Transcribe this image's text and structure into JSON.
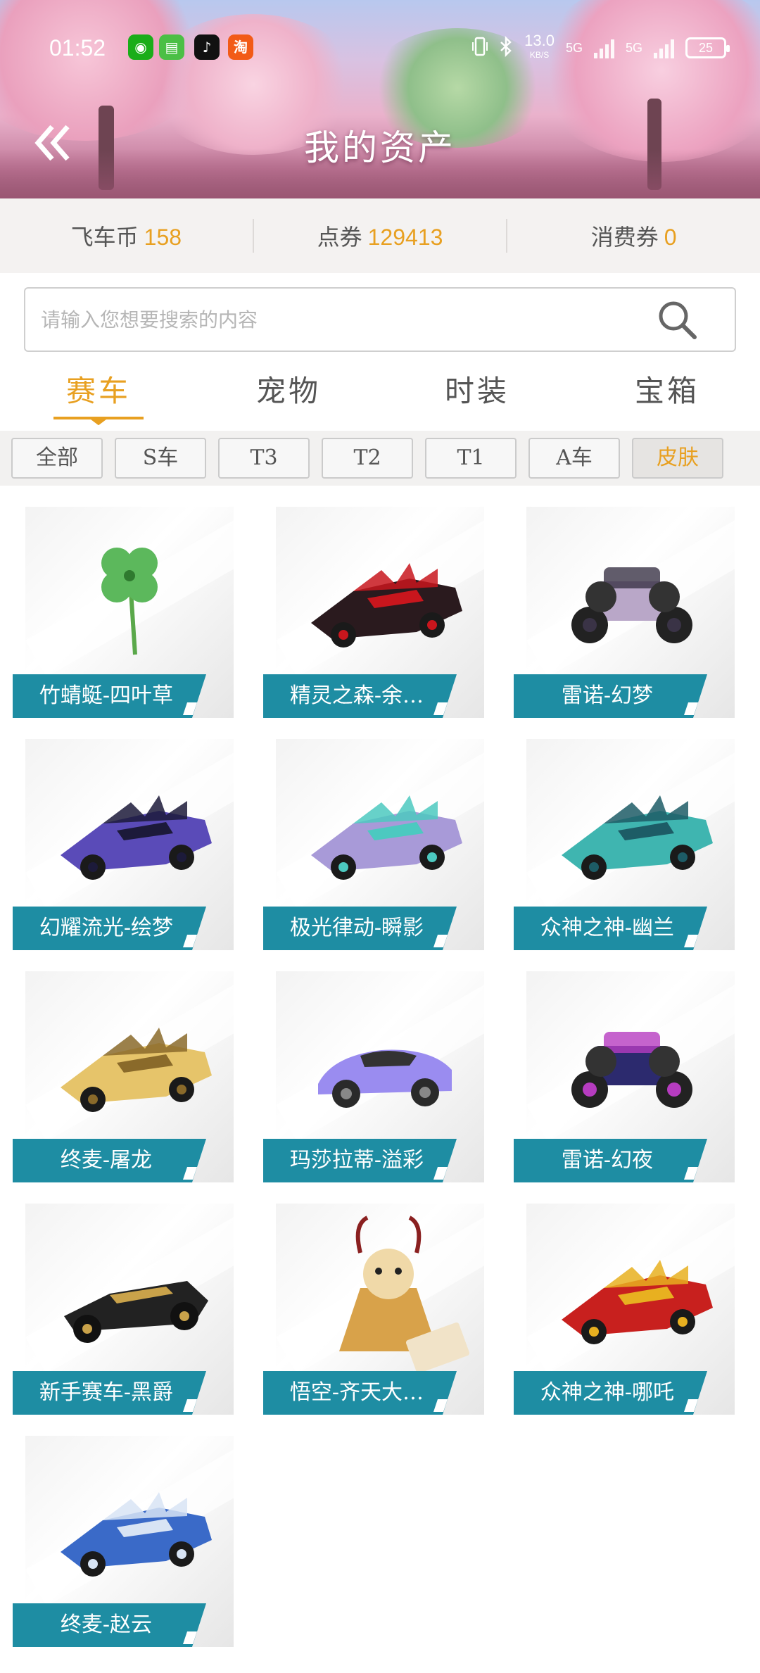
{
  "status_bar": {
    "time": "01:52",
    "net_speed": "13.0",
    "net_unit": "KB/S",
    "gen1": "5G",
    "gen2": "5G",
    "battery": "25",
    "app_icons": [
      {
        "name": "wechat-icon",
        "glyph": "◉",
        "color": "#1aad19"
      },
      {
        "name": "messages-icon",
        "glyph": "▤",
        "color": "#4bbf45"
      },
      {
        "name": "tiktok-icon",
        "glyph": "♪",
        "color": "#111111"
      },
      {
        "name": "taobao-icon",
        "glyph": "淘",
        "color": "#f25b17"
      }
    ]
  },
  "header": {
    "title": "我的资产",
    "back_icon": "double-chevron-left-icon"
  },
  "currency": [
    {
      "label": "飞车币",
      "value": "158"
    },
    {
      "label": "点券",
      "value": "129413"
    },
    {
      "label": "消费券",
      "value": "0"
    }
  ],
  "search": {
    "placeholder": "请输入您想要搜索的内容",
    "value": ""
  },
  "tabs": [
    "赛车",
    "宠物",
    "时装",
    "宝箱"
  ],
  "active_tab": 0,
  "filters": [
    "全部",
    "S车",
    "T3",
    "T2",
    "T1",
    "A车",
    "皮肤"
  ],
  "active_filter": 6,
  "items": [
    {
      "label": "竹蜻蜓-四叶草",
      "art": "clover",
      "c1": "#5cb85c",
      "c2": "#2f7a2f"
    },
    {
      "label": "精灵之森-余…",
      "art": "car",
      "c1": "#2a1a1e",
      "c2": "#c8161d"
    },
    {
      "label": "雷诺-幻梦",
      "art": "buggy",
      "c1": "#b9a7c8",
      "c2": "#3a3346"
    },
    {
      "label": "幻耀流光-绘梦",
      "art": "car",
      "c1": "#5a4bb8",
      "c2": "#1c1a3a"
    },
    {
      "label": "极光律动-瞬影",
      "art": "car",
      "c1": "#a89ad8",
      "c2": "#4cc9c0"
    },
    {
      "label": "众神之神-幽兰",
      "art": "car",
      "c1": "#3fb5b0",
      "c2": "#1d5c66"
    },
    {
      "label": "终麦-屠龙",
      "art": "car",
      "c1": "#e6c46a",
      "c2": "#8a6a2a"
    },
    {
      "label": "玛莎拉蒂-溢彩",
      "art": "sport",
      "c1": "#9a8cf0",
      "c2": "#2a2a2a"
    },
    {
      "label": "雷诺-幻夜",
      "art": "buggy",
      "c1": "#2c2a6e",
      "c2": "#b63cc0"
    },
    {
      "label": "新手赛车-黑爵",
      "art": "kart",
      "c1": "#222222",
      "c2": "#c9a24a"
    },
    {
      "label": "悟空-齐天大…",
      "art": "monkey",
      "c1": "#d8a24a",
      "c2": "#8a2020"
    },
    {
      "label": "众神之神-哪吒",
      "art": "car",
      "c1": "#c8201e",
      "c2": "#e8b020"
    },
    {
      "label": "终麦-赵云",
      "art": "car",
      "c1": "#3a6ac8",
      "c2": "#d8e4f4"
    }
  ],
  "colors": {
    "accent": "#e8a021",
    "label_teal": "#1e8da3",
    "chip_border": "#cbcbcb"
  }
}
